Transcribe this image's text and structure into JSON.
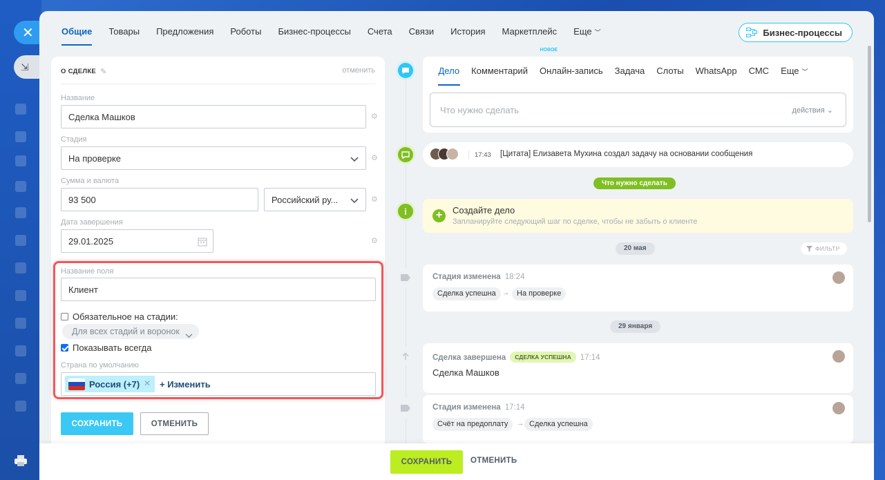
{
  "sidebar": {
    "close_icon": "close-icon",
    "tab_icon": "collapse-icon"
  },
  "topnav": {
    "tabs": [
      {
        "label": "Общие"
      },
      {
        "label": "Товары"
      },
      {
        "label": "Предложения"
      },
      {
        "label": "Роботы"
      },
      {
        "label": "Бизнес-процессы"
      },
      {
        "label": "Счета"
      },
      {
        "label": "Связи"
      },
      {
        "label": "История"
      },
      {
        "label": "Маркетплейс"
      },
      {
        "label": "Еще"
      }
    ],
    "bp_button": "Бизнес-процессы"
  },
  "deal": {
    "header": "О СДЕЛКЕ",
    "cancel": "отменить",
    "name_label": "Название",
    "name_value": "Сделка Машков",
    "stage_label": "Стадия",
    "stage_value": "На проверке",
    "amount_label": "Сумма и валюта",
    "amount_value": "93 500",
    "currency_value": "Российский ру...",
    "close_date_label": "Дата завершения",
    "close_date_value": "29.01.2025",
    "field_name_label": "Название поля",
    "field_name_value": "Клиент",
    "required_label": "Обязательное на стадии:",
    "required_checked": false,
    "required_scope": "Для всех стадий и воронок",
    "always_show_label": "Показывать всегда",
    "always_show_checked": true,
    "default_country_label": "Страна по умолчанию",
    "country_chip": "Россия (+7)",
    "country_change": "+ Изменить",
    "save": "СОХРАНИТЬ",
    "cancel_btn": "ОТМЕНИТЬ"
  },
  "composer": {
    "tabs": [
      {
        "label": "Дело"
      },
      {
        "label": "Комментарий"
      },
      {
        "label": "Онлайн-запись",
        "badge": "НОВОЕ"
      },
      {
        "label": "Задача"
      },
      {
        "label": "Слоты"
      },
      {
        "label": "WhatsApp"
      },
      {
        "label": "СМС"
      },
      {
        "label": "Еще"
      }
    ],
    "placeholder": "Что нужно сделать",
    "actions": "действия"
  },
  "timeline": {
    "comment_time": "17:43",
    "comment_text": "[Цитата] Елизавета Мухина создал задачу на основании сообщения",
    "todo_pill": "Что нужно сделать",
    "todo_title": "Создайте дело",
    "todo_sub": "Запланируйте следующий шаг по сделке, чтобы не забыть о клиенте",
    "date1": "20 мая",
    "filter": "ФИЛЬТР",
    "item1": {
      "title": "Стадия изменена",
      "time": "18:24",
      "from": "Сделка успешна",
      "to": "На проверке"
    },
    "date2": "29 января",
    "item2": {
      "title": "Сделка завершена",
      "badge": "СДЕЛКА УСПЕШНА",
      "time": "17:14",
      "body": "Сделка Машков"
    },
    "item3": {
      "title": "Стадия изменена",
      "time": "17:14",
      "from": "Счёт на предоплату",
      "to": "Сделка успешна"
    }
  },
  "bottom": {
    "save": "СОХРАНИТЬ",
    "cancel": "ОТМЕНИТЬ"
  },
  "colors": {
    "accent_blue": "#2fc6f6",
    "link_blue": "#0b66c3",
    "green": "#7fbf22",
    "save_lime": "#bbed21",
    "highlight_red": "#f0575b"
  }
}
